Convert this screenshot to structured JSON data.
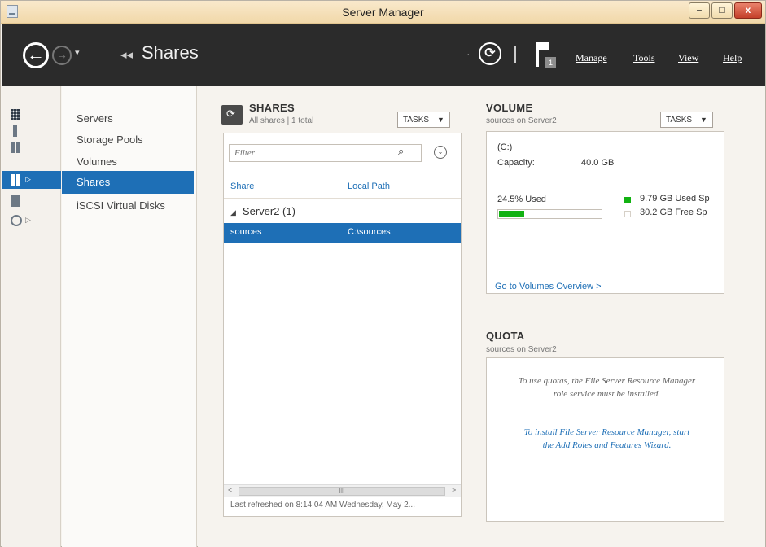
{
  "window": {
    "title": "Server Manager",
    "min_glyph": "–",
    "max_glyph": "□",
    "close_glyph": "x"
  },
  "header": {
    "back_glyph": "←",
    "forward_glyph": "→",
    "dropdown_glyph": "▾",
    "crumb_sep": "◂◂",
    "breadcrumb": "Shares",
    "dot_glyph": "·",
    "refresh_glyph": "⟳",
    "notification_count": "1",
    "menu": [
      "Manage",
      "Tools",
      "View",
      "Help"
    ]
  },
  "rail": {
    "icons": [
      "dashboard-icon",
      "local-server-icon",
      "all-servers-icon",
      "file-storage-icon",
      "iis-icon",
      "hyper-v-icon"
    ],
    "expand_glyph": "▷"
  },
  "subnav": {
    "items": [
      "Servers",
      "Storage Pools",
      "Volumes",
      "Shares",
      "iSCSI Virtual Disks"
    ],
    "selected": "Shares"
  },
  "shares": {
    "title": "SHARES",
    "subtitle": "All shares | 1 total",
    "tasks_label": "TASKS",
    "filter_placeholder": "Filter",
    "search_glyph": "⌕",
    "expand_glyph": "⌄",
    "columns": [
      "Share",
      "Local Path"
    ],
    "group_glyph": "◢",
    "group": "Server2 (1)",
    "rows": [
      {
        "share": "sources",
        "path": "C:\\sources"
      }
    ],
    "scroll_left": "<",
    "scroll_right": ">",
    "scroll_thumb": "III",
    "last_refreshed": "Last refreshed on 8:14:04 AM Wednesday, May 2..."
  },
  "volume": {
    "title": "VOLUME",
    "subtitle": "sources on Server2",
    "tasks_label": "TASKS",
    "drive": "(C:)",
    "capacity_label": "Capacity:",
    "capacity_value": "40.0 GB",
    "used_label": "24.5% Used",
    "used_fraction": 0.245,
    "used_legend": "9.79 GB Used Sp",
    "free_legend": "30.2 GB Free Sp",
    "used_color": "#12b212",
    "link": "Go to Volumes Overview >"
  },
  "quota": {
    "title": "QUOTA",
    "subtitle": "sources on Server2",
    "message1": "To use quotas, the File Server Resource Manager",
    "message2": "role service must be installed.",
    "link1": "To install File Server Resource Manager, start",
    "link2": "the Add Roles and Features Wizard."
  },
  "colors": {
    "accent": "#1e6fb6",
    "header_bg": "#2b2b2b",
    "close_button": "#c4402a"
  }
}
